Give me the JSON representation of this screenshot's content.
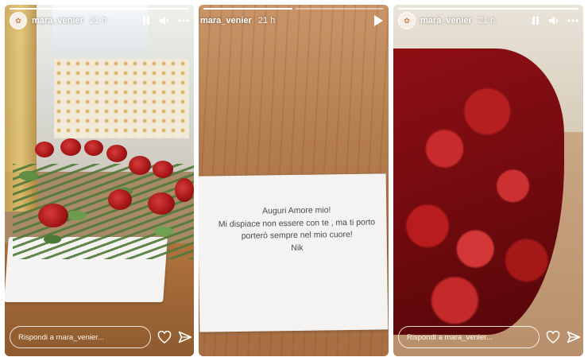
{
  "stories": [
    {
      "username": "mara_venier",
      "time": "21 h",
      "progress": {
        "segments": 1,
        "active": 0
      },
      "reply_placeholder": "Rispondi a mara_venier...",
      "icons": [
        "pause-icon",
        "volume-icon",
        "more-icon",
        "heart-icon",
        "send-icon"
      ]
    },
    {
      "username": "mara_venier",
      "time": "21 h",
      "progress": {
        "segments": 2,
        "active": 0
      },
      "note_lines": [
        "Auguri Amore mio!",
        "Mi dispiace non essere con te , ma ti porto",
        "porterò sempre nel mio cuore!",
        "Nik"
      ],
      "icons": [
        "play-icon"
      ]
    },
    {
      "username": "mara_venier",
      "time": "21 h",
      "progress": {
        "segments": 1,
        "active": 0
      },
      "reply_placeholder": "Rispondi a mara_venier...",
      "icons": [
        "pause-icon",
        "volume-icon",
        "more-icon",
        "heart-icon",
        "send-icon"
      ]
    }
  ],
  "colors": {
    "overlay_text": "#ffffff",
    "rose_red": "#a81818",
    "leaf_green": "#5f8f45"
  }
}
